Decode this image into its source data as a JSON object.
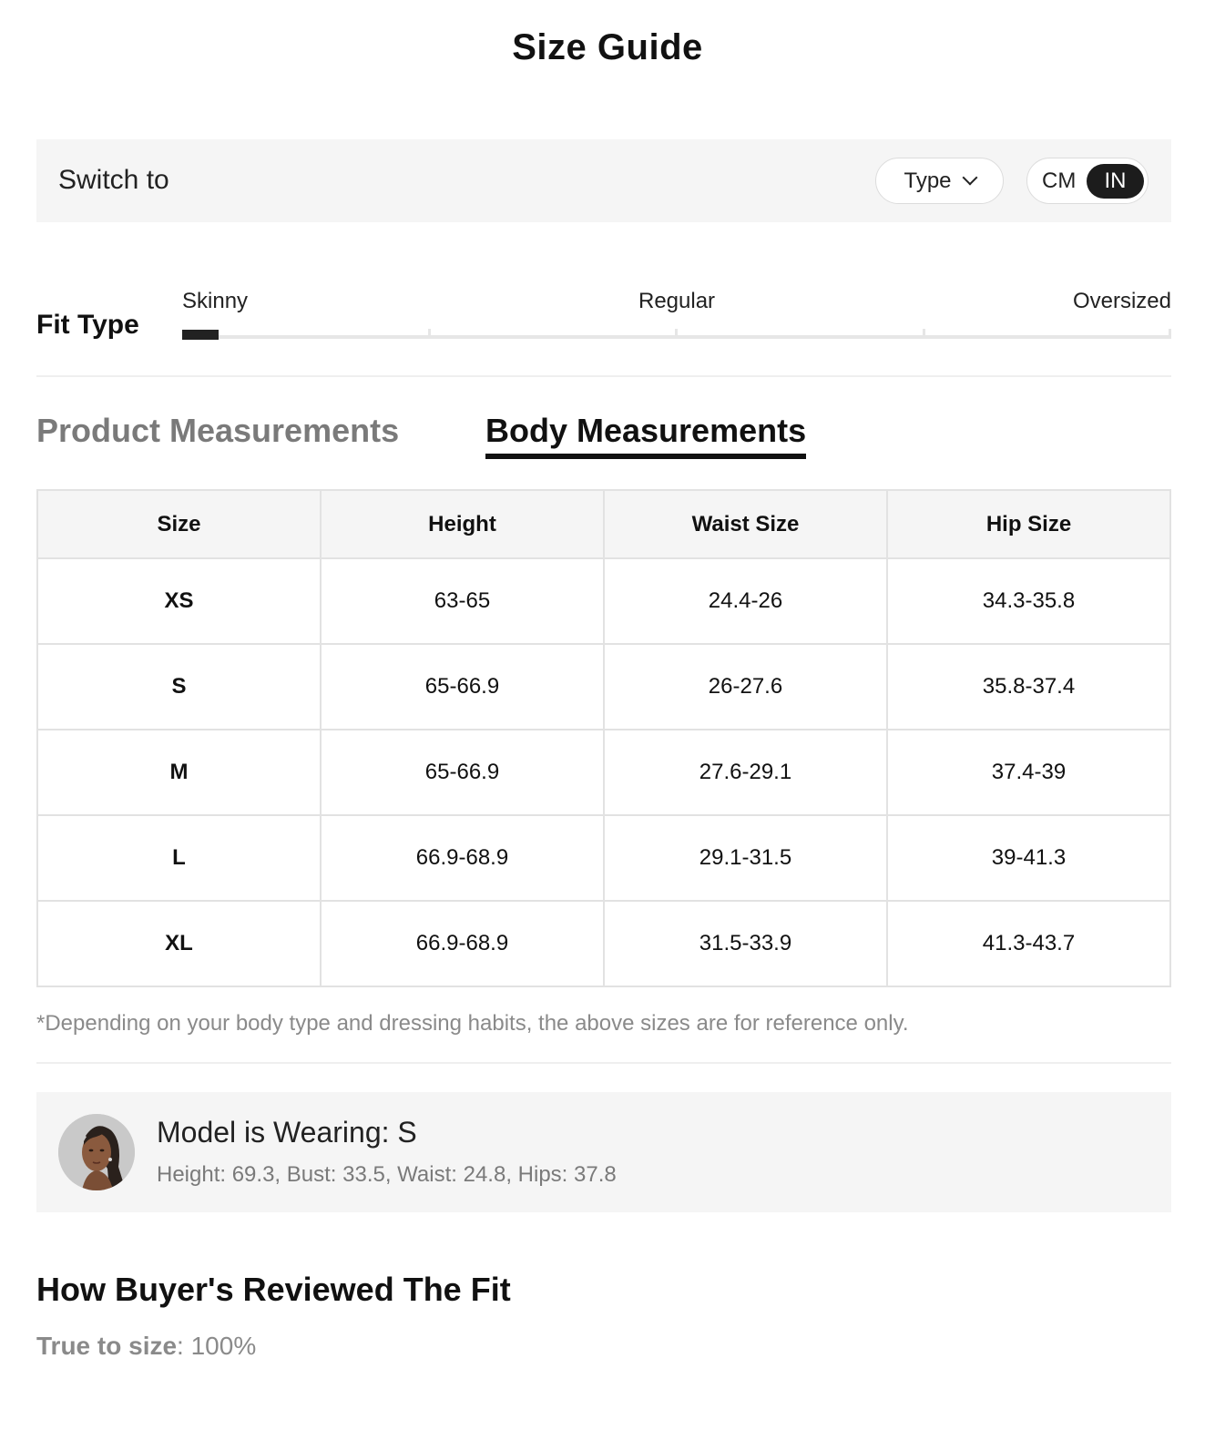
{
  "header": {
    "title": "Size Guide"
  },
  "switch_bar": {
    "label": "Switch to",
    "type_button": "Type",
    "unit_options": [
      "CM",
      "IN"
    ],
    "selected_unit": "IN"
  },
  "fit_type": {
    "label": "Fit Type",
    "scale_labels": [
      "Skinny",
      "Regular",
      "Oversized"
    ],
    "selected_level": 0
  },
  "tabs": {
    "product": "Product Measurements",
    "body": "Body Measurements",
    "active": "Body Measurements"
  },
  "table": {
    "headers": [
      "Size",
      "Height",
      "Waist Size",
      "Hip Size"
    ],
    "rows": [
      [
        "XS",
        "63-65",
        "24.4-26",
        "34.3-35.8"
      ],
      [
        "S",
        "65-66.9",
        "26-27.6",
        "35.8-37.4"
      ],
      [
        "M",
        "65-66.9",
        "27.6-29.1",
        "37.4-39"
      ],
      [
        "L",
        "66.9-68.9",
        "29.1-31.5",
        "39-41.3"
      ],
      [
        "XL",
        "66.9-68.9",
        "31.5-33.9",
        "41.3-43.7"
      ]
    ]
  },
  "note": "*Depending on your body type and dressing habits, the above sizes are for reference only.",
  "model": {
    "title": "Model is Wearing: S",
    "stats": "Height: 69.3,  Bust: 33.5,  Waist: 24.8,  Hips: 37.8"
  },
  "reviews": {
    "title": "How Buyer's Reviewed The Fit",
    "label": "True to size",
    "value": ": 100%"
  }
}
